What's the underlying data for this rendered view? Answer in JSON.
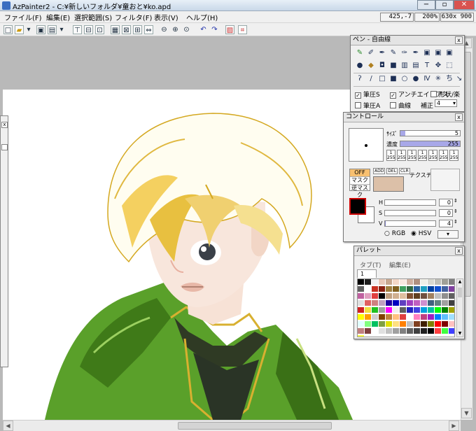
{
  "window": {
    "title": "AzPainter2 - C:¥新しいフォルダ¥童おと¥ko.apd",
    "minimize": "−",
    "maximize": "▫",
    "close": "✕"
  },
  "menu": [
    "ファイル(F)",
    "編集(E)",
    "選択範囲(S)",
    "フィルタ(F)",
    "表示(V)",
    "ヘルプ(H)"
  ],
  "status": {
    "coords": "425,-7",
    "zoom": "200%",
    "size": "630x 900"
  },
  "toolbar_icons": [
    "new-icon",
    "open-icon",
    "dropdown-icon",
    "save-icon",
    "save-as-icon",
    "dropdown-icon",
    "layer-icon",
    "layer-icon",
    "layer-icon",
    "grid-icon",
    "grid-icon",
    "grid-icon",
    "flip-icon",
    "zoom-out-icon",
    "zoom-in-icon",
    "zoom-reset-icon",
    "undo-icon",
    "redo-icon",
    "clear-icon",
    "capture-icon"
  ],
  "pen_panel": {
    "title": "ペン - 自由線",
    "close": "x",
    "row1": [
      "pen-icon",
      "brush-icon",
      "pen-icon",
      "pen-icon",
      "airbrush-icon",
      "pen-icon",
      "layer-icon",
      "layer-icon",
      "layer-icon"
    ],
    "row2": [
      "drop-icon",
      "bucket-icon",
      "shape-icon",
      "fill-icon",
      "gradient-icon",
      "text-icon",
      "T",
      "move-icon",
      "select-icon"
    ],
    "row3": [
      "ʔ",
      "/",
      "□",
      "■",
      "○",
      "●",
      "Ⅳ",
      "✳",
      "ち",
      "↘"
    ],
    "options": [
      {
        "label": "筆圧S",
        "checked": true
      },
      {
        "label": "アンチエイリアス",
        "checked": true
      },
      {
        "label": "形状/楽",
        "checked": false
      },
      {
        "label": "筆圧A",
        "checked": false
      },
      {
        "label": "曲線",
        "checked": false
      }
    ],
    "hosei_label": "補正",
    "hosei_value": "4"
  },
  "control_panel": {
    "title": "コントロール",
    "size_label": "ｻｲｽﾞ",
    "size_value": "5",
    "density_label": "濃度",
    "density_value": "255",
    "presets": [
      {
        "top": "1",
        "bottom": "255"
      },
      {
        "top": "1",
        "bottom": "255"
      },
      {
        "top": "1",
        "bottom": "255"
      },
      {
        "top": "1",
        "bottom": "255"
      },
      {
        "top": "1",
        "bottom": "255"
      },
      {
        "top": "1",
        "bottom": "255"
      },
      {
        "top": "1",
        "bottom": "255"
      }
    ],
    "mask_off": "OFF",
    "mask": "マスク",
    "reverse_mask": "逆マスク",
    "add": "ADD",
    "del": "DEL",
    "clr": "CLR",
    "texture": "テクスチャ",
    "h_label": "H",
    "h_value": "0",
    "s_label": "S",
    "s_value": "0",
    "v_label": "V",
    "v_value": "4",
    "rgb": "RGB",
    "hsv": "HSV",
    "mode": "hsv",
    "fg_color": "#000000",
    "bg_color": "#ffffff",
    "mask_color": "#dcc0a8"
  },
  "palette_panel": {
    "title": "パレット",
    "menu_tab": "タブ(T)",
    "menu_edit": "編集(E)",
    "tab_number": "1",
    "colors": [
      "#000000",
      "#1e1e1e",
      "#f0f0f0",
      "#e8c8b8",
      "#c8a890",
      "#f4d8c8",
      "#f8e8e0",
      "#d0b0a0",
      "#b09080",
      "#f0f0e8",
      "#d8d8d0",
      "#c0c0b8",
      "#a0a098",
      "#808080",
      "#606060",
      "#ffffff",
      "#c83020",
      "#882010",
      "#a08040",
      "#806020",
      "#40a060",
      "#306840",
      "#2860a0",
      "#20a0c0",
      "#0040a0",
      "#1050d0",
      "#4060a0",
      "#8040a0",
      "#c060a0",
      "#e0a0c0",
      "#e04040",
      "#000000",
      "#c0a080",
      "#d0b090",
      "#e0c0a0",
      "#805030",
      "#604020",
      "#705040",
      "#a08060",
      "#c0c0c0",
      "#909090",
      "#606060",
      "#e0e0e0",
      "#e06060",
      "#d08080",
      "#c0a0c0",
      "#2000a0",
      "#0000c0",
      "#6040c0",
      "#a040c0",
      "#c060c0",
      "#d090d0",
      "#406080",
      "#608080",
      "#a0a0a0",
      "#404040",
      "#d02020",
      "#f0e040",
      "#20c020",
      "#a0a0a0",
      "#ff00ff",
      "#f0f0f0",
      "#606060",
      "#2020c0",
      "#4040e0",
      "#00a0e0",
      "#00c0a0",
      "#00ff00",
      "#008000",
      "#a0a000",
      "#ffff00",
      "#ffa000",
      "#d0d0d0",
      "#804000",
      "#c08040",
      "#ffc080",
      "#e04040",
      "#ffffff",
      "#ff80c0",
      "#c04080",
      "#a020c0",
      "#0080ff",
      "#60c0ff",
      "#a0e0ff",
      "#e0ffff",
      "#80ff80",
      "#00c060",
      "#80a040",
      "#e0e000",
      "#ffe080",
      "#ff8000",
      "#c0c0c0",
      "#804020",
      "#402000",
      "#808000",
      "#ff0000",
      "#800000",
      "#ffc0c0",
      "#c08080",
      "#804040",
      "#ffffff",
      "#e0e0e0",
      "#c0c0c0",
      "#a0a0a0",
      "#808080",
      "#606060",
      "#404040",
      "#202020",
      "#000000",
      "#ff4040",
      "#40ff40",
      "#4040ff",
      "#ffff40"
    ]
  }
}
